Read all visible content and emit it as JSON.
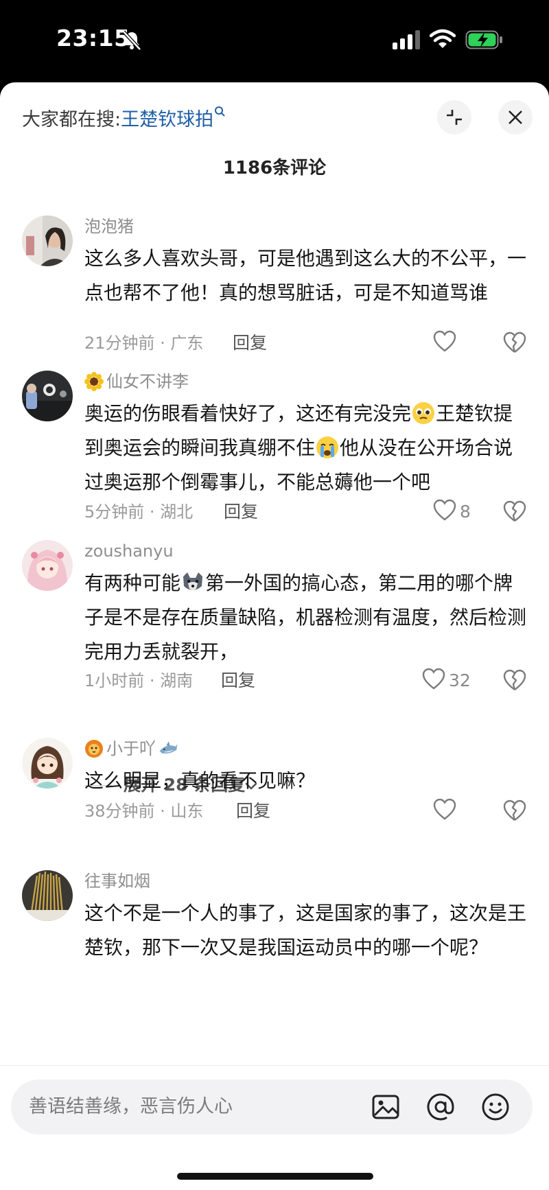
{
  "status_bar": {
    "time": "23:15"
  },
  "header": {
    "search_prefix": "大家都在搜:",
    "search_keyword": "王楚钦球拍",
    "comment_count_title": "1186条评论"
  },
  "comments": [
    {
      "username": "泡泡猪",
      "text": "这么多人喜欢头哥，可是他遇到这么大的不公平，一点也帮不了他！真的想骂脏话，可是不知道骂谁",
      "meta": "21分钟前 · 广东",
      "reply_label": "回复",
      "likes": ""
    },
    {
      "username": "仙女不讲李",
      "name_emoji": "sunflower-emoji",
      "text_1": "奥运的伤眼看着快好了，这还有完没完",
      "text_2": "王楚钦提到奥运会的瞬间我真绷不住",
      "text_3": "他从没在公开场合说过奥运那个倒霉事儿，不能总薅他一个吧",
      "inline_emoji_1": "pleading-face-emoji",
      "inline_emoji_2": "crying-face-emoji",
      "meta": "5分钟前 · 湖北",
      "reply_label": "回复",
      "likes": "8"
    },
    {
      "username": "zoushanyu",
      "text_1": "有两种可能",
      "text_2": "第一外国的搞心态，第二用的哪个牌子是不是存在质量缺陷，机器检测有温度，然后检测完用力丢就裂开，",
      "inline_emoji_1": "wolf-emoji",
      "meta": "1小时前 · 湖南",
      "reply_label": "回复",
      "likes": "32"
    },
    {
      "username": "小于吖",
      "name_emoji_before": "lion-emoji",
      "name_emoji_after": "shark-emoji",
      "text": "这么明显，真的看不见嘛？",
      "meta": "38分钟前 · 山东",
      "reply_label": "回复",
      "likes": ""
    },
    {
      "username": "往事如烟",
      "text": "这个不是一个人的事了，这是国家的事了，这次是王楚钦，那下一次又是我国运动员中的哪一个呢？"
    }
  ],
  "expand_replies": {
    "label": "展开 28 条回复"
  },
  "input_bar": {
    "placeholder": "善语结善缘，恶言伤人心"
  },
  "colors": {
    "keyword": "#1f5fa8",
    "meta": "#9a9a9a",
    "text": "#161616"
  }
}
